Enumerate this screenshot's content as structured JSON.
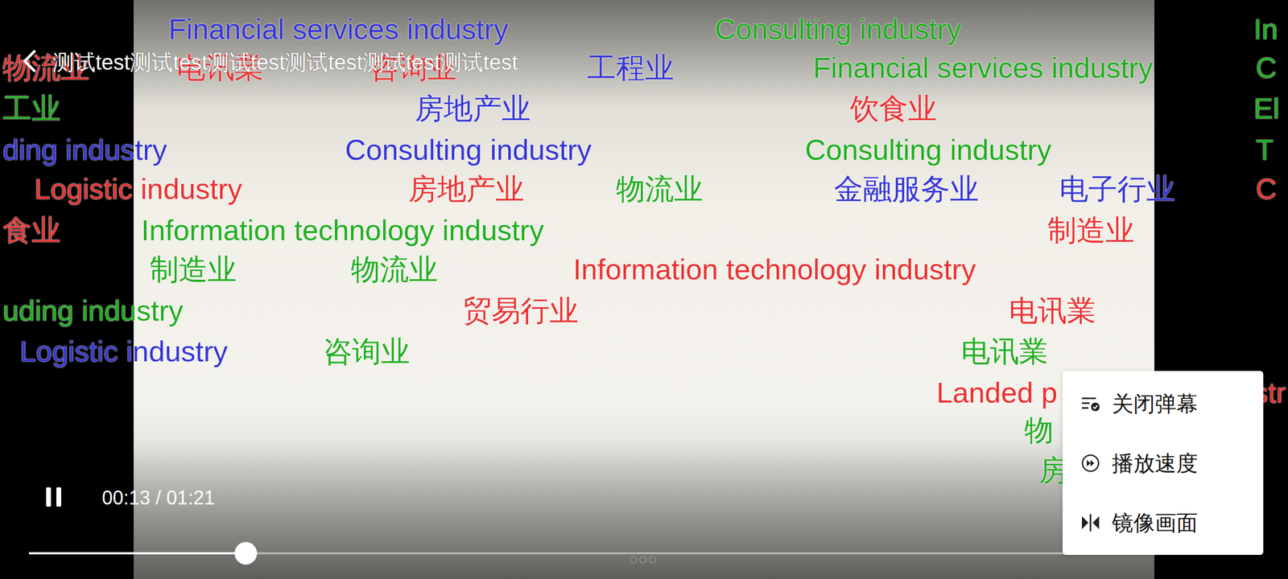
{
  "header": {
    "title": "测试test测试test测试test测试test测试test测试test"
  },
  "danmaku": [
    {
      "text": "Financial services industry",
      "color": "#3434d8"
    },
    {
      "text": "Consulting industry",
      "color": "#1fae1f"
    },
    {
      "text": "In",
      "color": "#1fae1f"
    },
    {
      "text": "物流业",
      "color": "#ec3030"
    },
    {
      "text": "电讯業",
      "color": "#ec3030"
    },
    {
      "text": "咨询业",
      "color": "#ec3030"
    },
    {
      "text": "工程业",
      "color": "#3434d8"
    },
    {
      "text": "Financial services industry",
      "color": "#1fae1f"
    },
    {
      "text": "C",
      "color": "#1fae1f"
    },
    {
      "text": "工业",
      "color": "#1fae1f"
    },
    {
      "text": "房地产业",
      "color": "#3434d8"
    },
    {
      "text": "饮食业",
      "color": "#ec3030"
    },
    {
      "text": "El",
      "color": "#1fae1f"
    },
    {
      "text": "ding industry",
      "color": "#3434d8"
    },
    {
      "text": "Consulting industry",
      "color": "#3434d8"
    },
    {
      "text": "Consulting industry",
      "color": "#1fae1f"
    },
    {
      "text": "T",
      "color": "#1fae1f"
    },
    {
      "text": "Logistic industry",
      "color": "#ec3030"
    },
    {
      "text": "房地产业",
      "color": "#ec3030"
    },
    {
      "text": "物流业",
      "color": "#1fae1f"
    },
    {
      "text": "金融服务业",
      "color": "#3434d8"
    },
    {
      "text": "电子行业",
      "color": "#3434d8"
    },
    {
      "text": "C",
      "color": "#ec3030"
    },
    {
      "text": "食业",
      "color": "#ec3030"
    },
    {
      "text": "Information technology industry",
      "color": "#1fae1f"
    },
    {
      "text": "制造业",
      "color": "#ec3030"
    },
    {
      "text": "制造业",
      "color": "#1fae1f"
    },
    {
      "text": "物流业",
      "color": "#1fae1f"
    },
    {
      "text": "Information technology industry",
      "color": "#ec3030"
    },
    {
      "text": "uding industry",
      "color": "#1fae1f"
    },
    {
      "text": "贸易行业",
      "color": "#ec3030"
    },
    {
      "text": "电讯業",
      "color": "#ec3030"
    },
    {
      "text": "Logistic industry",
      "color": "#3434d8"
    },
    {
      "text": "咨询业",
      "color": "#1fae1f"
    },
    {
      "text": "电讯業",
      "color": "#1fae1f"
    },
    {
      "text": "Landed p",
      "color": "#ec3030"
    },
    {
      "text": "str",
      "color": "#ec3030"
    },
    {
      "text": "物",
      "color": "#1fae1f"
    },
    {
      "text": "房",
      "color": "#1fae1f"
    }
  ],
  "player": {
    "playing": true,
    "time": "00:13 / 01:21",
    "progress": {
      "level": 0.176
    }
  },
  "menu": {
    "items": [
      {
        "label": "关闭弹幕"
      },
      {
        "label": "播放速度"
      },
      {
        "label": "镜像画面"
      }
    ]
  }
}
